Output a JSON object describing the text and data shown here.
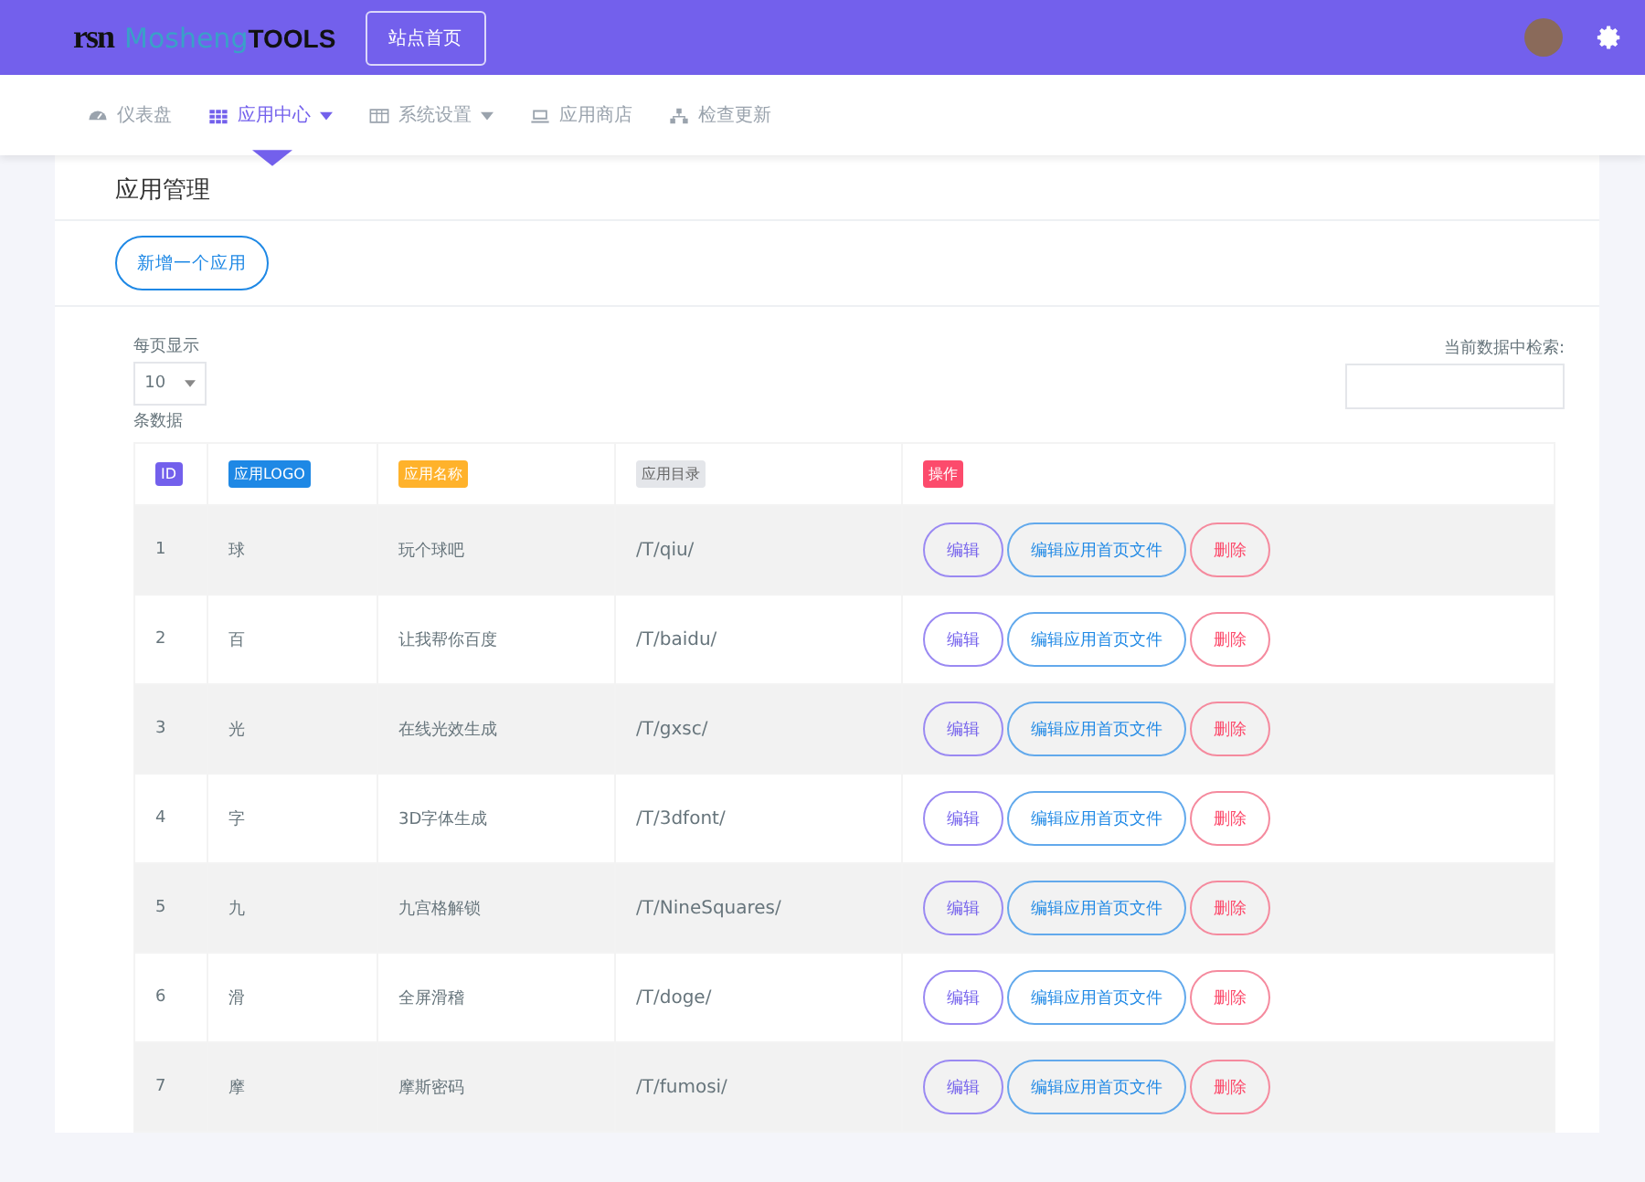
{
  "header": {
    "logo_mark": "rsn",
    "logo_brand": "Mosheng",
    "logo_suffix": "TOOLS",
    "home_button": "站点首页"
  },
  "nav": [
    {
      "label": "仪表盘",
      "kind": "gauge",
      "dropdown": false,
      "selected": false
    },
    {
      "label": "应用中心",
      "kind": "grid",
      "dropdown": true,
      "selected": true
    },
    {
      "label": "系统设置",
      "kind": "table",
      "dropdown": true,
      "selected": false
    },
    {
      "label": "应用商店",
      "kind": "laptop",
      "dropdown": false,
      "selected": false
    },
    {
      "label": "检查更新",
      "kind": "sitemap",
      "dropdown": false,
      "selected": false
    }
  ],
  "page_title": "应用管理",
  "add_button": "新增一个应用",
  "length_control": {
    "label_before": "每页显示",
    "value": "10",
    "label_after": "条数据"
  },
  "search": {
    "label": "当前数据中检索:"
  },
  "table": {
    "columns": [
      {
        "label": "ID",
        "color": "#7360ec"
      },
      {
        "label": "应用LOGO",
        "color": "#1e88e5"
      },
      {
        "label": "应用名称",
        "color": "#ffb22b"
      },
      {
        "label": "应用目录",
        "color": "#e4e6ea"
      },
      {
        "label": "操作",
        "color": "#fc4b6c"
      }
    ],
    "rows": [
      {
        "id": "1",
        "logo": "球",
        "name": "玩个球吧",
        "dir": "/T/qiu/",
        "actions": [
          "编辑",
          "编辑应用首页文件",
          "删除"
        ]
      },
      {
        "id": "2",
        "logo": "百",
        "name": "让我帮你百度",
        "dir": "/T/baidu/",
        "actions": [
          "编辑",
          "编辑应用首页文件",
          "删除"
        ]
      },
      {
        "id": "3",
        "logo": "光",
        "name": "在线光效生成",
        "dir": "/T/gxsc/",
        "actions": [
          "编辑",
          "编辑应用首页文件",
          "删除"
        ]
      },
      {
        "id": "4",
        "logo": "字",
        "name": "3D字体生成",
        "dir": "/T/3dfont/",
        "actions": [
          "编辑",
          "编辑应用首页文件",
          "删除"
        ]
      },
      {
        "id": "5",
        "logo": "九",
        "name": "九宫格解锁",
        "dir": "/T/NineSquares/",
        "actions": [
          "编辑",
          "编辑应用首页文件",
          "删除"
        ]
      },
      {
        "id": "6",
        "logo": "滑",
        "name": "全屏滑稽",
        "dir": "/T/doge/",
        "actions": [
          "编辑",
          "编辑应用首页文件",
          "删除"
        ]
      },
      {
        "id": "7",
        "logo": "摩",
        "name": "摩斯密码",
        "dir": "/T/fumosi/",
        "actions": [
          "编辑",
          "编辑应用首页文件",
          "删除"
        ]
      }
    ]
  }
}
